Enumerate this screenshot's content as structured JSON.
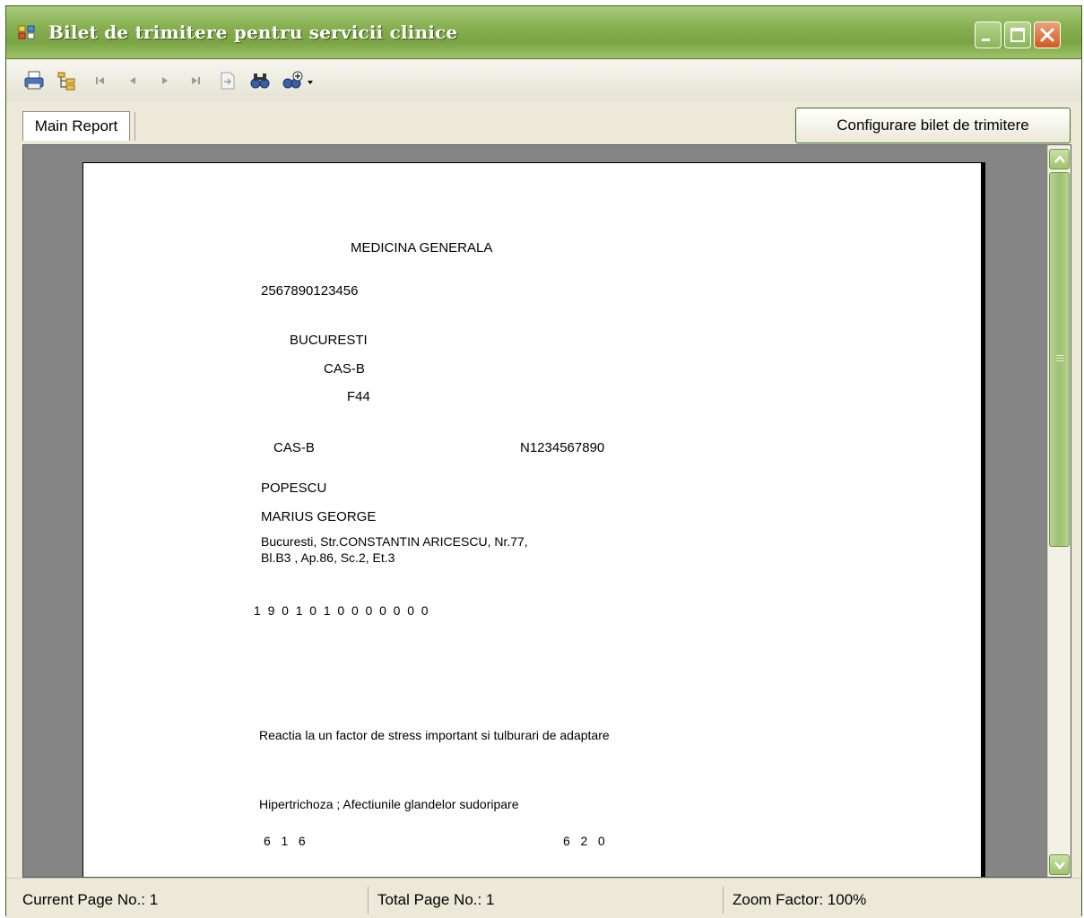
{
  "window": {
    "title": "Bilet de trimitere pentru servicii clinice"
  },
  "toolbar": {
    "tools": [
      "print-icon",
      "group-tree-icon",
      "first-page-icon",
      "previous-page-icon",
      "next-page-icon",
      "last-page-icon",
      "goto-page-icon",
      "find-icon",
      "zoom-icon"
    ]
  },
  "tabs": {
    "main_report": "Main Report"
  },
  "config_button": "Configurare bilet de trimitere",
  "report": {
    "specialty": "MEDICINA GENERALA",
    "code": "2567890123456",
    "city": "BUCURESTI",
    "cas_header": "CAS-B",
    "diag_code": "F44",
    "cas": "CAS-B",
    "number": "N1234567890",
    "last_name": "POPESCU",
    "first_name": "MARIUS GEORGE",
    "address_line1": "Bucuresti, Str.CONSTANTIN ARICESCU, Nr.77,",
    "address_line2": "Bl.B3 , Ap.86, Sc.2, Et.3",
    "cnp_digits": "1  9  0  1  0  1  0  0  0  0  0  0  0",
    "diagnosis1": "Reactia la un factor de stress important si tulburari de adaptare",
    "diagnosis2": "Hipertrichoza ; Afectiunile glandelor sudoripare",
    "code_left": "6   1   6",
    "code_right": "6   2   0"
  },
  "status": {
    "current_page": "Current Page No.: 1",
    "total_page": "Total Page No.: 1",
    "zoom": "Zoom Factor: 100%"
  }
}
